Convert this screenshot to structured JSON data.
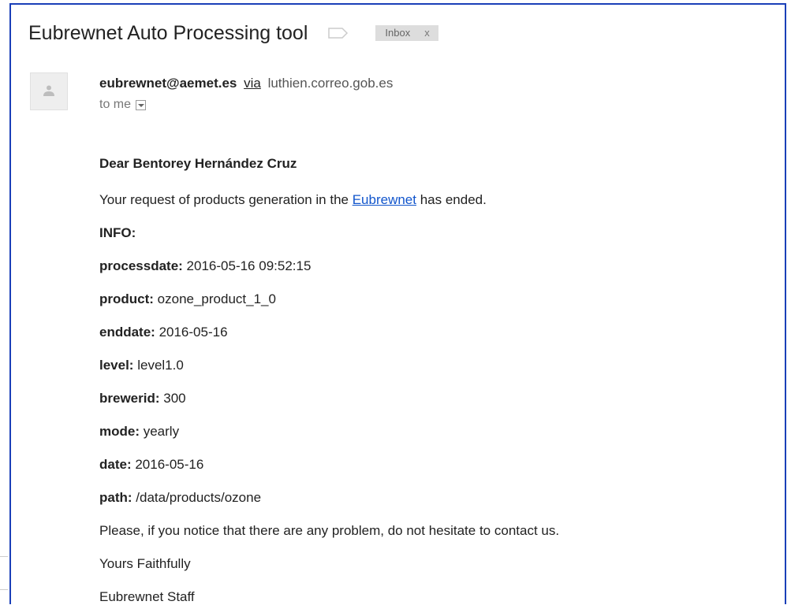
{
  "email": {
    "subject": "Eubrewnet Auto Processing tool",
    "inbox_chip": {
      "label": "Inbox",
      "close": "x"
    },
    "sender": {
      "email": "eubrewnet@aemet.es",
      "via_label": "via",
      "via_domain": "luthien.correo.gob.es"
    },
    "recipient_label": "to me"
  },
  "body": {
    "greeting": "Dear Bentorey Hernández Cruz",
    "request_prefix": "Your request of products generation in the ",
    "request_link": "Eubrewnet",
    "request_suffix": " has ended.",
    "info_heading": "INFO:",
    "fields": [
      {
        "key": "processdate:",
        "value": " 2016-05-16 09:52:15"
      },
      {
        "key": "product:",
        "value": " ozone_product_1_0"
      },
      {
        "key": "enddate:",
        "value": " 2016-05-16"
      },
      {
        "key": "level:",
        "value": " level1.0"
      },
      {
        "key": "brewerid:",
        "value": " 300"
      },
      {
        "key": "mode:",
        "value": " yearly"
      },
      {
        "key": "date:",
        "value": " 2016-05-16"
      },
      {
        "key": "path:",
        "value": " /data/products/ozone"
      }
    ],
    "notice": "Please, if you notice that there are any problem, do not hesitate to contact us.",
    "closing": "Yours Faithfully",
    "signature": "Eubrewnet Staff"
  },
  "colors": {
    "frame_border": "#1a3fb8",
    "link": "#1155cc",
    "chip_bg": "#dddddd"
  },
  "icons": {
    "avatar": "person-icon",
    "label": "label-tag-icon",
    "dropdown": "chevron-down-icon"
  }
}
